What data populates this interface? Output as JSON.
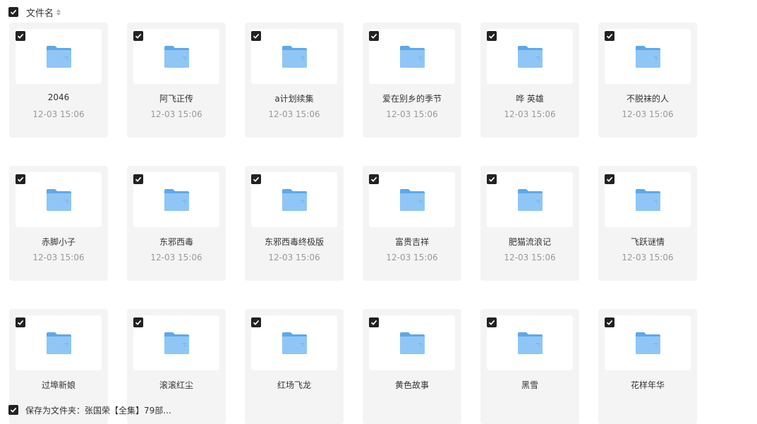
{
  "header": {
    "select_all_label": "文件名"
  },
  "folders": [
    [
      {
        "name": "2046",
        "time": "12-03 15:06"
      },
      {
        "name": "阿飞正传",
        "time": "12-03 15:06"
      },
      {
        "name": "a计划续集",
        "time": "12-03 15:06"
      },
      {
        "name": "爱在别乡的季节",
        "time": "12-03 15:06"
      },
      {
        "name": "哗 英雄",
        "time": "12-03 15:06"
      },
      {
        "name": "不脱袜的人",
        "time": "12-03 15:06"
      }
    ],
    [
      {
        "name": "赤脚小子",
        "time": "12-03 15:06"
      },
      {
        "name": "东邪西毒",
        "time": "12-03 15:06"
      },
      {
        "name": "东邪西毒终极版",
        "time": "12-03 15:06"
      },
      {
        "name": "富贵吉祥",
        "time": "12-03 15:06"
      },
      {
        "name": "肥猫流浪记",
        "time": "12-03 15:06"
      },
      {
        "name": "飞跃谜情",
        "time": "12-03 15:06"
      }
    ],
    [
      {
        "name": "过埠新娘",
        "time": ""
      },
      {
        "name": "滚滚红尘",
        "time": ""
      },
      {
        "name": "红场飞龙",
        "time": ""
      },
      {
        "name": "黄色故事",
        "time": ""
      },
      {
        "name": "黑雪",
        "time": ""
      },
      {
        "name": "花样年华",
        "time": ""
      }
    ]
  ],
  "footer": {
    "label": "保存为文件夹：张国荣【全集】79部..."
  },
  "colors": {
    "checkbox": "#222222",
    "card_bg": "#f4f4f4",
    "folder": "#7bbcf0",
    "time_text": "#999999"
  }
}
